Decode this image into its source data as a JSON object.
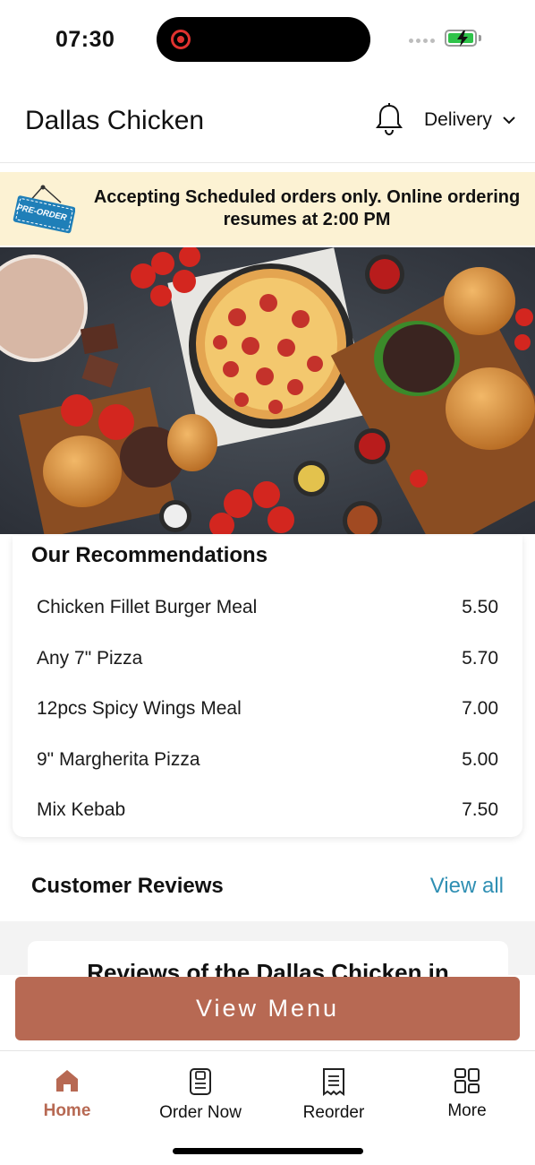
{
  "status_bar": {
    "time": "07:30"
  },
  "header": {
    "title": "Dallas Chicken",
    "delivery_label": "Delivery"
  },
  "banner": {
    "tag_text": "PRE-ORDER",
    "message": "Accepting Scheduled orders only. Online ordering resumes at 2:00 PM"
  },
  "recommendations": {
    "title": "Our Recommendations",
    "items": [
      {
        "name": "Chicken Fillet Burger Meal",
        "price": "5.50"
      },
      {
        "name": "Any 7\" Pizza",
        "price": "5.70"
      },
      {
        "name": "12pcs Spicy Wings Meal",
        "price": "7.00"
      },
      {
        "name": "9\" Margherita Pizza",
        "price": "5.00"
      },
      {
        "name": "Mix Kebab",
        "price": "7.50"
      }
    ]
  },
  "reviews": {
    "title": "Customer Reviews",
    "view_all": "View all",
    "card_title": "Reviews of the Dallas Chicken in"
  },
  "cta": {
    "view_menu": "View Menu"
  },
  "tabs": [
    {
      "label": "Home",
      "icon": "home-icon",
      "active": true
    },
    {
      "label": "Order Now",
      "icon": "order-icon",
      "active": false
    },
    {
      "label": "Reorder",
      "icon": "receipt-icon",
      "active": false
    },
    {
      "label": "More",
      "icon": "grid-icon",
      "active": false
    }
  ],
  "colors": {
    "accent": "#b76953",
    "banner_bg": "#fcf2d3",
    "link": "#2f8fb3"
  }
}
